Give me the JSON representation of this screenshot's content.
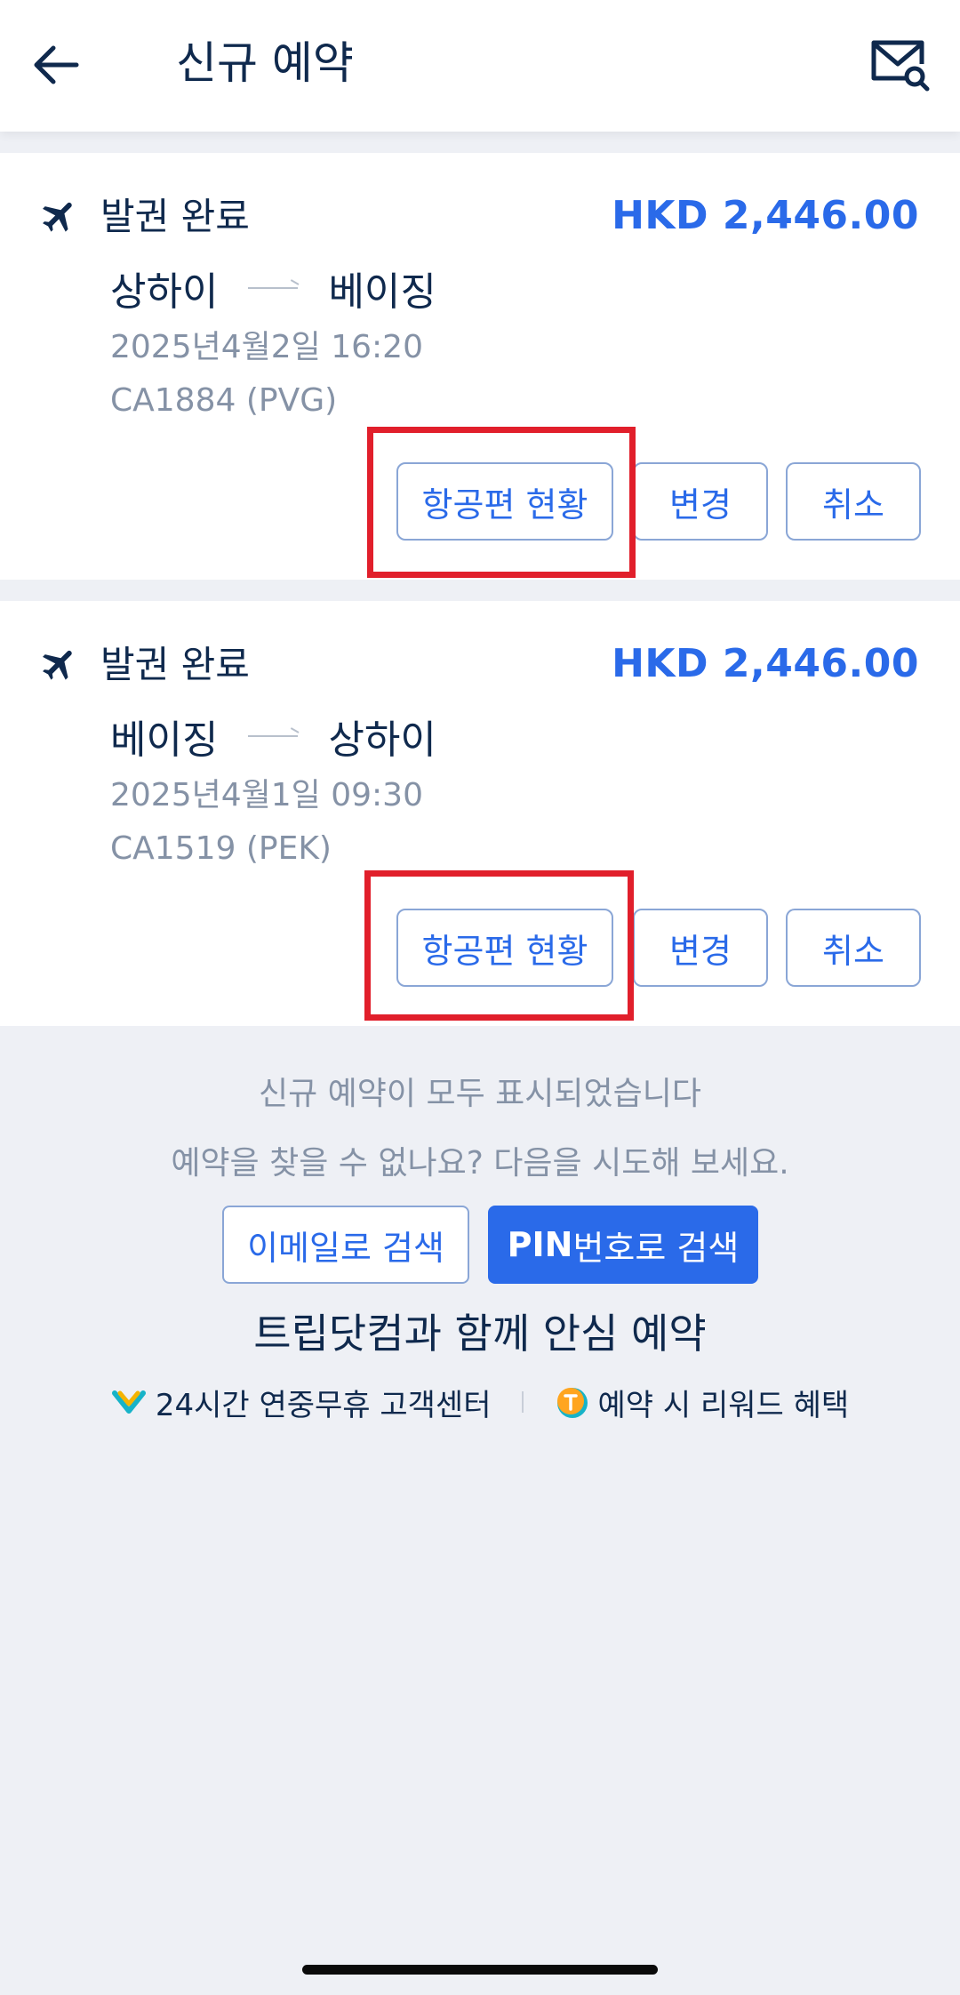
{
  "header": {
    "title": "신규 예약",
    "back_icon": "arrow-left-icon",
    "mail_icon": "mail-search-icon"
  },
  "bookings": [
    {
      "status": "발권 완료",
      "price": "HKD 2,446.00",
      "origin": "상하이",
      "destination": "베이징",
      "datetime": "2025년4월2일 16:20",
      "flight": "CA1884 (PVG)",
      "btn_status": "항공편 현황",
      "btn_change": "변경",
      "btn_cancel": "취소"
    },
    {
      "status": "발권 완료",
      "price": "HKD 2,446.00",
      "origin": "베이징",
      "destination": "상하이",
      "datetime": "2025년4월1일 09:30",
      "flight": "CA1519 (PEK)",
      "btn_status": "항공편 현황",
      "btn_change": "변경",
      "btn_cancel": "취소"
    }
  ],
  "footer": {
    "all_shown": "신규 예약이 모두 표시되었습니다",
    "not_found": "예약을 찾을 수 없나요? 다음을 시도해 보세요.",
    "email_search": "이메일로 검색",
    "pin_bold": "PIN",
    "pin_rest": "번호로 검색",
    "trust_title": "트립닷컴과 함께 안심 예약",
    "benefit_1": "24시간 연중무휴 고객센터",
    "benefit_2": "예약 시 리워드 혜택"
  },
  "colors": {
    "accent": "#2a6ae9",
    "highlight": "#e11f2b",
    "text": "#0f294d",
    "muted": "#8592a6",
    "background": "#eef0f5"
  }
}
